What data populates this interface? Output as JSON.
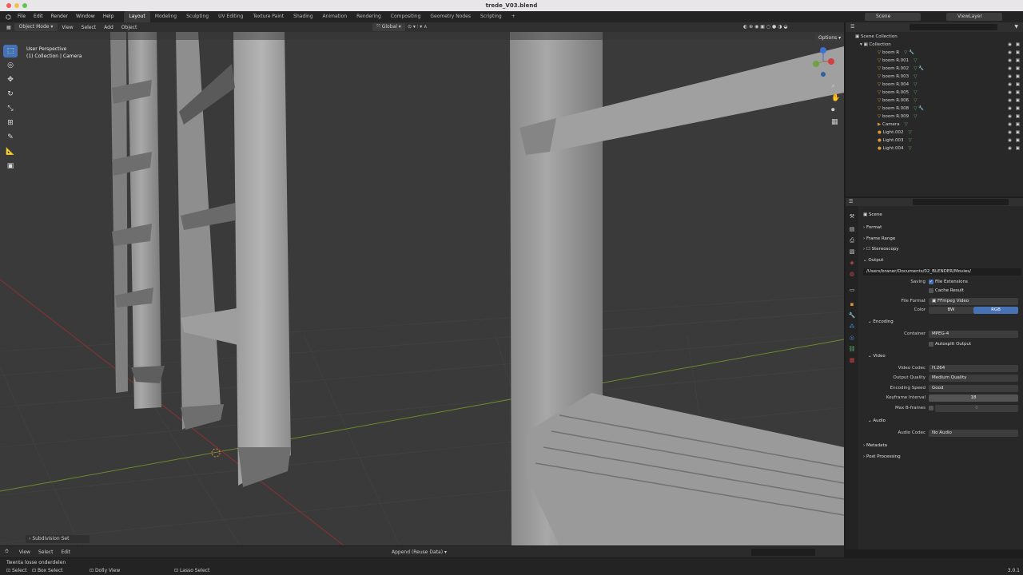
{
  "window": {
    "title": "trede_V03.blend"
  },
  "menus": [
    "File",
    "Edit",
    "Render",
    "Window",
    "Help"
  ],
  "workspaces": [
    "Layout",
    "Modeling",
    "Sculpting",
    "UV Editing",
    "Texture Paint",
    "Shading",
    "Animation",
    "Rendering",
    "Compositing",
    "Geometry Nodes",
    "Scripting"
  ],
  "active_workspace": "Layout",
  "scene": {
    "name": "Scene",
    "view_layer": "ViewLayer"
  },
  "viewport": {
    "mode": "Object Mode",
    "menus": [
      "View",
      "Select",
      "Add",
      "Object"
    ],
    "orientation": "Global",
    "perspective": "User Perspective",
    "context": "(1) Collection | Camera",
    "options_label": "Options",
    "operator_panel": "Subdivision Set"
  },
  "outliner": {
    "root": "Scene Collection",
    "collection": "Collection",
    "items": [
      {
        "name": "boom R",
        "icon": "mesh-icon",
        "extra": "modifier-icon"
      },
      {
        "name": "boom R.001",
        "icon": "mesh-icon",
        "extra": ""
      },
      {
        "name": "boom R.002",
        "icon": "mesh-icon",
        "extra": "modifier-icon"
      },
      {
        "name": "boom R.003",
        "icon": "mesh-icon",
        "extra": ""
      },
      {
        "name": "boom R.004",
        "icon": "mesh-icon",
        "extra": ""
      },
      {
        "name": "boom R.005",
        "icon": "mesh-icon",
        "extra": ""
      },
      {
        "name": "boom R.006",
        "icon": "mesh-icon",
        "extra": ""
      },
      {
        "name": "boom R.008",
        "icon": "mesh-icon",
        "extra": "modifier-icon"
      },
      {
        "name": "boom R.009",
        "icon": "mesh-icon",
        "extra": ""
      },
      {
        "name": "Camera",
        "icon": "camera-icon",
        "extra": "camera-data-icon"
      },
      {
        "name": "Light.002",
        "icon": "light-icon",
        "extra": "light-data-icon"
      },
      {
        "name": "Light.003",
        "icon": "light-icon",
        "extra": "light-data-icon"
      },
      {
        "name": "Light.004",
        "icon": "light-icon",
        "extra": "light-data-icon"
      }
    ]
  },
  "properties": {
    "context": "Scene",
    "sections": {
      "format": "Format",
      "frame_range": "Frame Range",
      "stereoscopy": "Stereoscopy",
      "output": "Output",
      "encoding": "Encoding",
      "video": "Video",
      "audio": "Audio",
      "metadata": "Metadata",
      "post_processing": "Post Processing"
    },
    "output_path": "/Users/braner/Documents/02_BLENDER/Movies/",
    "saving_label": "Saving",
    "file_extensions": "File Extensions",
    "cache_result": "Cache Result",
    "file_format_label": "File Format",
    "file_format": "FFmpeg Video",
    "color_label": "Color",
    "color_bw": "BW",
    "color_rgb": "RGB",
    "container_label": "Container",
    "container": "MPEG-4",
    "autosplit": "Autosplit Output",
    "video_codec_label": "Video Codec",
    "video_codec": "H.264",
    "output_quality_label": "Output Quality",
    "output_quality": "Medium Quality",
    "encoding_speed_label": "Encoding Speed",
    "encoding_speed": "Good",
    "keyframe_label": "Keyframe Interval",
    "keyframe": "18",
    "bframes_label": "Max B-frames",
    "bframes": "0",
    "audio_codec_label": "Audio Codec",
    "audio_codec": "No Audio"
  },
  "timeline": {
    "menus": [
      "View",
      "Select",
      "Edit"
    ],
    "append": "Append (Reuse Data)"
  },
  "status": {
    "operator": "Twenta losse onderdelen",
    "select": "Select",
    "box_select": "Box Select",
    "dolly": "Dolly View",
    "lasso": "Lasso Select",
    "version": "3.0.1"
  },
  "colors": {
    "accent": "#4772b3",
    "header": "#303030",
    "panel": "#282828"
  }
}
